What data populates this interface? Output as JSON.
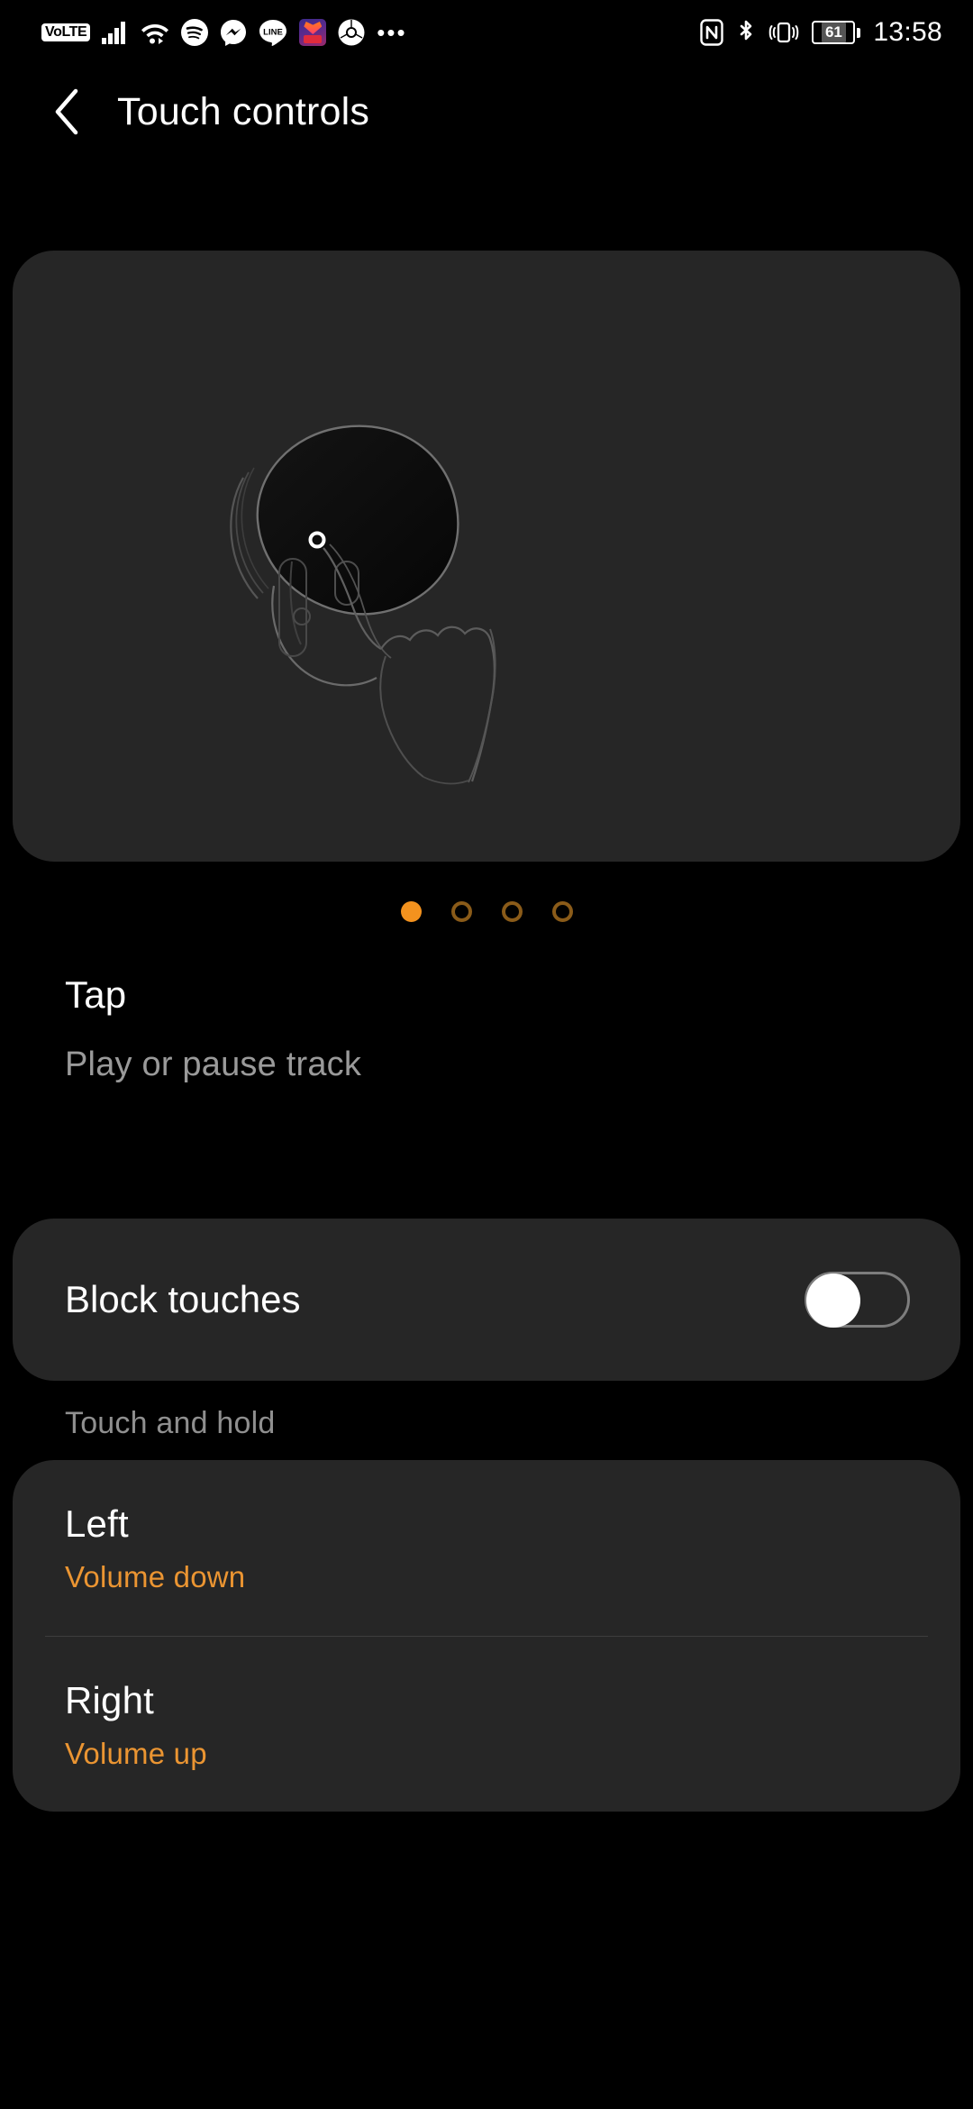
{
  "status_bar": {
    "left_icons": [
      {
        "name": "volte-icon",
        "label": "VoLTE"
      },
      {
        "name": "cellular-signal-icon",
        "label": "signal"
      },
      {
        "name": "wifi-icon",
        "label": "wifi"
      },
      {
        "name": "spotify-icon",
        "label": "Spotify"
      },
      {
        "name": "messenger-icon",
        "label": "Messenger"
      },
      {
        "name": "line-icon",
        "label": "LINE"
      },
      {
        "name": "lazada-icon",
        "label": "Lazada"
      },
      {
        "name": "chrome-icon",
        "label": "Chrome"
      },
      {
        "name": "more-notifications-icon",
        "label": "•••"
      }
    ],
    "right_icons": [
      {
        "name": "nfc-icon",
        "label": "NFC"
      },
      {
        "name": "bluetooth-icon",
        "label": "Bluetooth"
      },
      {
        "name": "vibrate-icon",
        "label": "Vibrate"
      }
    ],
    "battery_percent": "61",
    "clock": "13:58"
  },
  "appbar": {
    "back_label": "Back",
    "title": "Touch controls"
  },
  "illustration": {
    "alt": "Earbud being tapped by a finger"
  },
  "pager": {
    "total": 4,
    "active_index": 0,
    "active_color": "#f3921e",
    "inactive_color": "#8a5b19"
  },
  "gesture": {
    "name": "Tap",
    "description": "Play or pause track"
  },
  "block_touches": {
    "label": "Block touches",
    "enabled": false
  },
  "touch_and_hold": {
    "header": "Touch and hold",
    "rows": [
      {
        "title": "Left",
        "value": "Volume down"
      },
      {
        "title": "Right",
        "value": "Volume up"
      }
    ],
    "value_color": "#eb9532"
  }
}
